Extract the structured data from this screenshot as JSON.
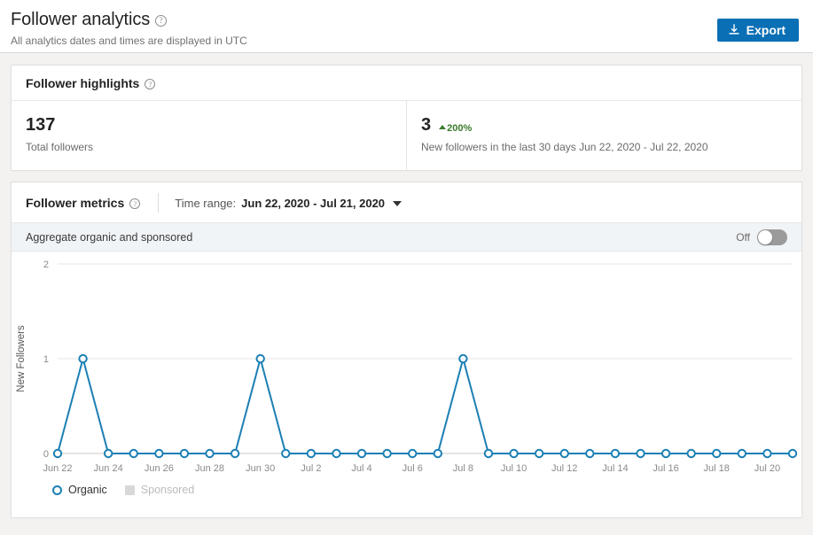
{
  "header": {
    "title": "Follower analytics",
    "help_icon": "help-circle-icon",
    "subtitle": "All analytics dates and times are displayed in UTC",
    "export_label": "Export",
    "export_icon": "download-icon",
    "export_color": "#0a6fb5"
  },
  "highlights": {
    "card_title": "Follower highlights",
    "help_icon": "help-circle-icon",
    "cells": [
      {
        "value": "137",
        "delta": "",
        "label": "Total followers"
      },
      {
        "value": "3",
        "delta": "200%",
        "delta_direction": "up",
        "delta_color": "#3b7a2a",
        "label": "New followers in the last 30 days Jun 22, 2020 - Jul 22, 2020"
      }
    ]
  },
  "metrics": {
    "card_title": "Follower metrics",
    "help_icon": "help-circle-icon",
    "time_range_label": "Time range:",
    "time_range_value": "Jun 22, 2020 - Jul 21, 2020",
    "dropdown_icon": "chevron-down-icon",
    "aggregate_label": "Aggregate organic and sponsored",
    "toggle_state": "Off",
    "toggle_on": false
  },
  "chart_data": {
    "type": "line",
    "title": "",
    "xlabel": "",
    "ylabel": "New Followers",
    "ylim": [
      0,
      2
    ],
    "yticks": [
      0,
      1,
      2
    ],
    "ytick_labels": [
      "0",
      "1",
      "2"
    ],
    "grid": true,
    "legend_position": "bottom-left",
    "x": [
      "Jun 22",
      "Jun 23",
      "Jun 24",
      "Jun 25",
      "Jun 26",
      "Jun 27",
      "Jun 28",
      "Jun 29",
      "Jun 30",
      "Jul 1",
      "Jul 2",
      "Jul 3",
      "Jul 4",
      "Jul 5",
      "Jul 6",
      "Jul 7",
      "Jul 8",
      "Jul 9",
      "Jul 10",
      "Jul 11",
      "Jul 12",
      "Jul 13",
      "Jul 14",
      "Jul 15",
      "Jul 16",
      "Jul 17",
      "Jul 18",
      "Jul 19",
      "Jul 20",
      "Jul 21"
    ],
    "xtick_labels": [
      "Jun 22",
      "",
      "Jun 24",
      "",
      "Jun 26",
      "",
      "Jun 28",
      "",
      "Jun 30",
      "",
      "Jul 2",
      "",
      "Jul 4",
      "",
      "Jul 6",
      "",
      "Jul 8",
      "",
      "Jul 10",
      "",
      "Jul 12",
      "",
      "Jul 14",
      "",
      "Jul 16",
      "",
      "Jul 18",
      "",
      "Jul 20",
      ""
    ],
    "series": [
      {
        "name": "Organic",
        "color": "#1b7fb5",
        "visible": true,
        "values": [
          0,
          1,
          0,
          0,
          0,
          0,
          0,
          0,
          1,
          0,
          0,
          0,
          0,
          0,
          0,
          0,
          1,
          0,
          0,
          0,
          0,
          0,
          0,
          0,
          0,
          0,
          0,
          0,
          0,
          0
        ]
      },
      {
        "name": "Sponsored",
        "color": "#d8d8d8",
        "visible": false,
        "values": []
      }
    ],
    "legend": [
      {
        "label": "Organic",
        "marker": "circle",
        "active": true
      },
      {
        "label": "Sponsored",
        "marker": "square",
        "active": false
      }
    ]
  }
}
